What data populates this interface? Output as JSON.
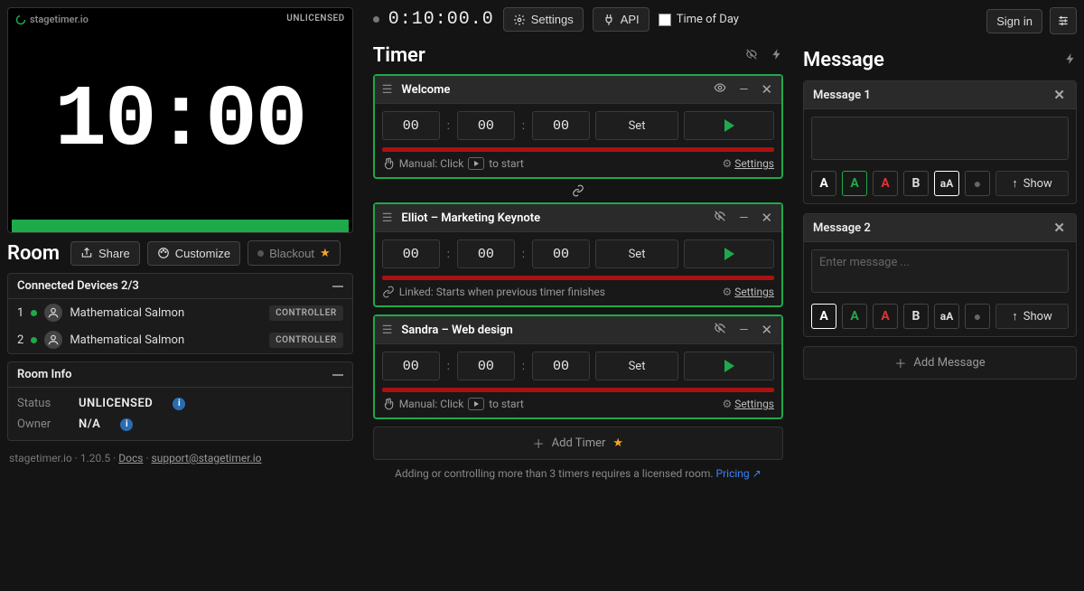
{
  "brand": "stagetimer.io",
  "license_tag": "UNLICENSED",
  "preview_time": "10:00",
  "room": {
    "title": "Room",
    "share": "Share",
    "customize": "Customize",
    "blackout": "Blackout"
  },
  "devices": {
    "header": "Connected Devices 2/3",
    "rows": [
      {
        "idx": "1",
        "name": "Mathematical Salmon",
        "role": "CONTROLLER"
      },
      {
        "idx": "2",
        "name": "Mathematical Salmon",
        "role": "CONTROLLER"
      }
    ]
  },
  "room_info": {
    "header": "Room Info",
    "status_label": "Status",
    "status_value": "UNLICENSED",
    "owner_label": "Owner",
    "owner_value": "N/A"
  },
  "footer": {
    "site": "stagetimer.io",
    "version": "1.20.5",
    "docs": "Docs",
    "support": "support@stagetimer.io"
  },
  "topbar": {
    "clock": "0:10:00.0",
    "settings": "Settings",
    "api": "API",
    "tod": "Time of Day",
    "signin": "Sign in"
  },
  "timer_section": "Timer",
  "timers": [
    {
      "name": "Welcome",
      "hh": "00",
      "mm": "00",
      "ss": "00",
      "set": "Set",
      "mode_prefix": "Manual: Click",
      "mode_suffix": "to start",
      "mode_icon": "play",
      "eye": "visible",
      "settings": "Settings"
    },
    {
      "name": "Elliot – Marketing Keynote",
      "hh": "00",
      "mm": "00",
      "ss": "00",
      "set": "Set",
      "mode_full": "Linked: Starts when previous timer finishes",
      "mode_icon": "link",
      "eye": "hidden",
      "settings": "Settings"
    },
    {
      "name": "Sandra – Web design",
      "hh": "00",
      "mm": "00",
      "ss": "00",
      "set": "Set",
      "mode_prefix": "Manual: Click",
      "mode_suffix": "to start",
      "mode_icon": "play",
      "eye": "hidden",
      "settings": "Settings"
    }
  ],
  "link_between": "link",
  "add_timer": "Add Timer",
  "timer_hint": "Adding or controlling more than 3 timers requires a licensed room.",
  "pricing": "Pricing",
  "message_section": "Message",
  "messages": [
    {
      "title": "Message 1",
      "value": "",
      "placeholder": "",
      "selected_color": "green",
      "selected_size": true
    },
    {
      "title": "Message 2",
      "value": "",
      "placeholder": "Enter message ...",
      "selected_color": "white",
      "selected_size": false
    }
  ],
  "msg_show": "Show",
  "add_message": "Add Message"
}
